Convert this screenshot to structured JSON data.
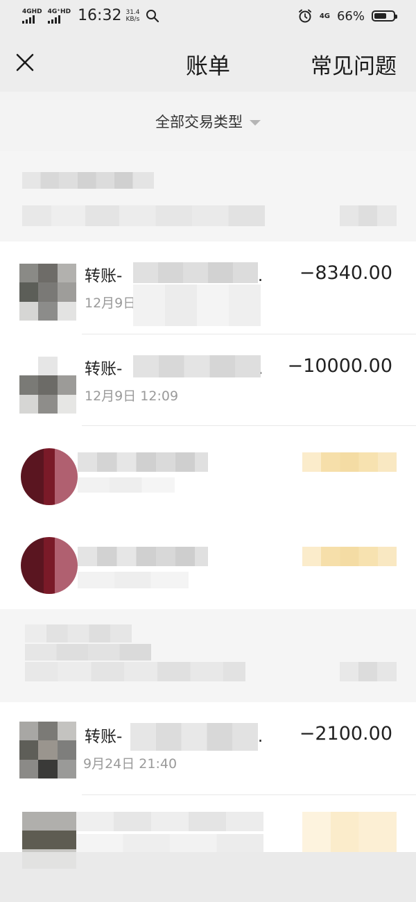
{
  "status_bar": {
    "signal1_label": "4GHD",
    "signal2_label": "4G⁺HD",
    "time": "16:32",
    "net_speed_value": "31.4",
    "net_speed_unit": "KB/s",
    "network_label": "4G",
    "battery_text": "66%",
    "battery_level": 0.66
  },
  "nav": {
    "title": "账单",
    "faq_label": "常见问题"
  },
  "filter": {
    "label": "全部交易类型"
  },
  "transactions": [
    {
      "title": "转账-",
      "title_tail": "…",
      "date": "12月9日",
      "amount": "−8340.00"
    },
    {
      "title": "转账-",
      "title_tail": "…",
      "date": "12月9日 12:09",
      "amount": "−10000.00"
    },
    {
      "title": "转账-",
      "title_tail": "…",
      "date": "9月24日 21:40",
      "amount": "−2100.00"
    }
  ],
  "colors": {
    "background": "#ededed",
    "card": "#ffffff",
    "text_primary": "#222222",
    "text_secondary": "#9a9a9a",
    "income_tint": "#f7e5b8",
    "avatar_red": "#7a1a28"
  }
}
